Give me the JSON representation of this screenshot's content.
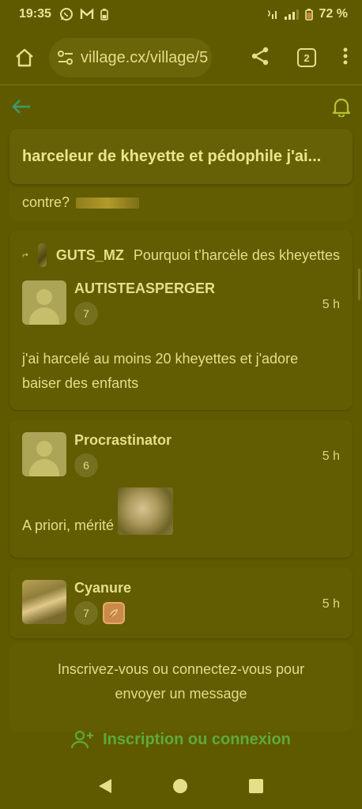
{
  "status": {
    "time": "19:35",
    "battery_percent": "72 %",
    "left_icons": [
      "whatsapp-icon",
      "gmail-icon",
      "battery-saver-icon"
    ],
    "right_icons": [
      "wifi-call-icon",
      "signal-icon",
      "battery-icon"
    ]
  },
  "browser": {
    "url": "village.cx/village/5",
    "tab_count": "2"
  },
  "topic": {
    "title": "harceleur de kheyette et pédophile j'ai..."
  },
  "previous_post": {
    "text_tail": "contre?"
  },
  "posts": [
    {
      "reply_to_user": "GUTS_MZ",
      "reply_to_text": "Pourquoi t’harcèle des kheyettes",
      "username": "AUTISTEASPERGER",
      "level": "7",
      "time": "5 h",
      "body": "j'ai harcelé au moins 20 kheyettes et j'adore baiser des enfants"
    },
    {
      "username": "Procrastinator",
      "level": "6",
      "time": "5 h",
      "body": "A priori, mérité"
    },
    {
      "username": "Cyanure",
      "level": "7",
      "time": "5 h",
      "badge_icon": "leaf-badge-icon"
    }
  ],
  "login_prompt": {
    "line1": "Inscrivez-vous ou connectez-vous pour",
    "line2": "envoyer un message",
    "button": "Inscription ou connexion"
  },
  "colors": {
    "background": "#5f5a00",
    "card": "#625c03",
    "accent_green": "#5fa93a",
    "text": "#e6df8a"
  }
}
